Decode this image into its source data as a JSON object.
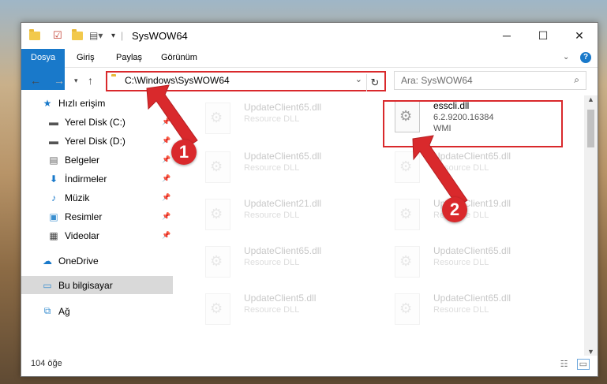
{
  "window": {
    "title": "SysWOW64",
    "controls": {
      "minimize": "─",
      "maximize": "☐",
      "close": "✕"
    }
  },
  "ribbon": {
    "tabs": [
      "Dosya",
      "Giriş",
      "Paylaş",
      "Görünüm"
    ],
    "collapse_icon": "chevron-down-icon",
    "help_icon": "help-icon"
  },
  "address": {
    "path": "C:\\Windows\\SysWOW64",
    "search_placeholder": "Ara: SysWOW64"
  },
  "sidebar": {
    "items": [
      {
        "label": "Hızlı erişim",
        "icon": "star-icon"
      },
      {
        "label": "Yerel Disk (C:)",
        "icon": "drive-icon"
      },
      {
        "label": "Yerel Disk (D:)",
        "icon": "drive-icon"
      },
      {
        "label": "Belgeler",
        "icon": "documents-icon"
      },
      {
        "label": "İndirmeler",
        "icon": "download-icon"
      },
      {
        "label": "Müzik",
        "icon": "music-icon"
      },
      {
        "label": "Resimler",
        "icon": "pictures-icon"
      },
      {
        "label": "Videolar",
        "icon": "videos-icon"
      },
      {
        "label": "OneDrive",
        "icon": "cloud-icon"
      },
      {
        "label": "Bu bilgisayar",
        "icon": "computer-icon"
      },
      {
        "label": "Ağ",
        "icon": "network-icon"
      }
    ]
  },
  "files": {
    "highlighted": {
      "name": "esscli.dll",
      "version": "6.2.9200.16384",
      "type": "WMI"
    },
    "left_column": [
      {
        "name": "UpdateClient65.dll",
        "type": "Resource DLL"
      },
      {
        "name": "UpdateClient65.dll",
        "type": "Resource DLL"
      },
      {
        "name": "UpdateClient21.dll",
        "type": "Resource DLL"
      },
      {
        "name": "UpdateClient65.dll",
        "type": "Resource DLL"
      },
      {
        "name": "UpdateClient5.dll",
        "type": "Resource DLL"
      }
    ],
    "right_column": [
      {
        "name": "UpdateClient65.dll",
        "type": "Resource DLL"
      },
      {
        "name": "UpdateClient19.dll",
        "type": "Resource DLL"
      },
      {
        "name": "UpdateClient65.dll",
        "type": "Resource DLL"
      },
      {
        "name": "UpdateClient65.dll",
        "type": "Resource DLL"
      }
    ]
  },
  "status": {
    "count": "104 öğe"
  },
  "annotations": {
    "step1": "1",
    "step2": "2",
    "accent": "#d9292c"
  }
}
